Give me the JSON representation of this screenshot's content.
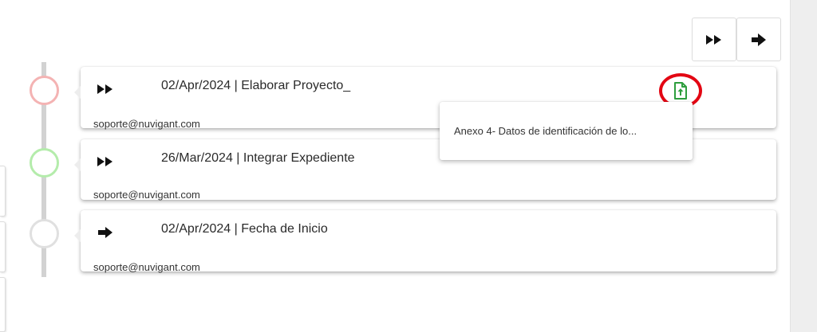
{
  "toolbar": {
    "fast_forward_icon": "fast-forward-icon",
    "arrow_icon": "arrow-right-icon"
  },
  "timeline": {
    "items": [
      {
        "title": "02/Apr/2024 | Elaborar Proyecto_",
        "user": "soporte@nuvigant.com",
        "icon": "fast-forward-icon",
        "status_color": "#f4b3b3"
      },
      {
        "title": "26/Mar/2024 | Integrar Expediente",
        "user": "soporte@nuvigant.com",
        "icon": "fast-forward-icon",
        "status_color": "#b4ecab"
      },
      {
        "title": "02/Apr/2024 | Fecha de Inicio",
        "user": "soporte@nuvigant.com",
        "icon": "arrow-right-icon",
        "status_color": "#e0e0e0"
      }
    ]
  },
  "attachments": {
    "icon": "file-upload-icon",
    "highlight_color": "#e30613",
    "icon_color": "#2e9e3e",
    "menu_items": [
      "Anexo 4- Datos de identificación de lo..."
    ]
  }
}
